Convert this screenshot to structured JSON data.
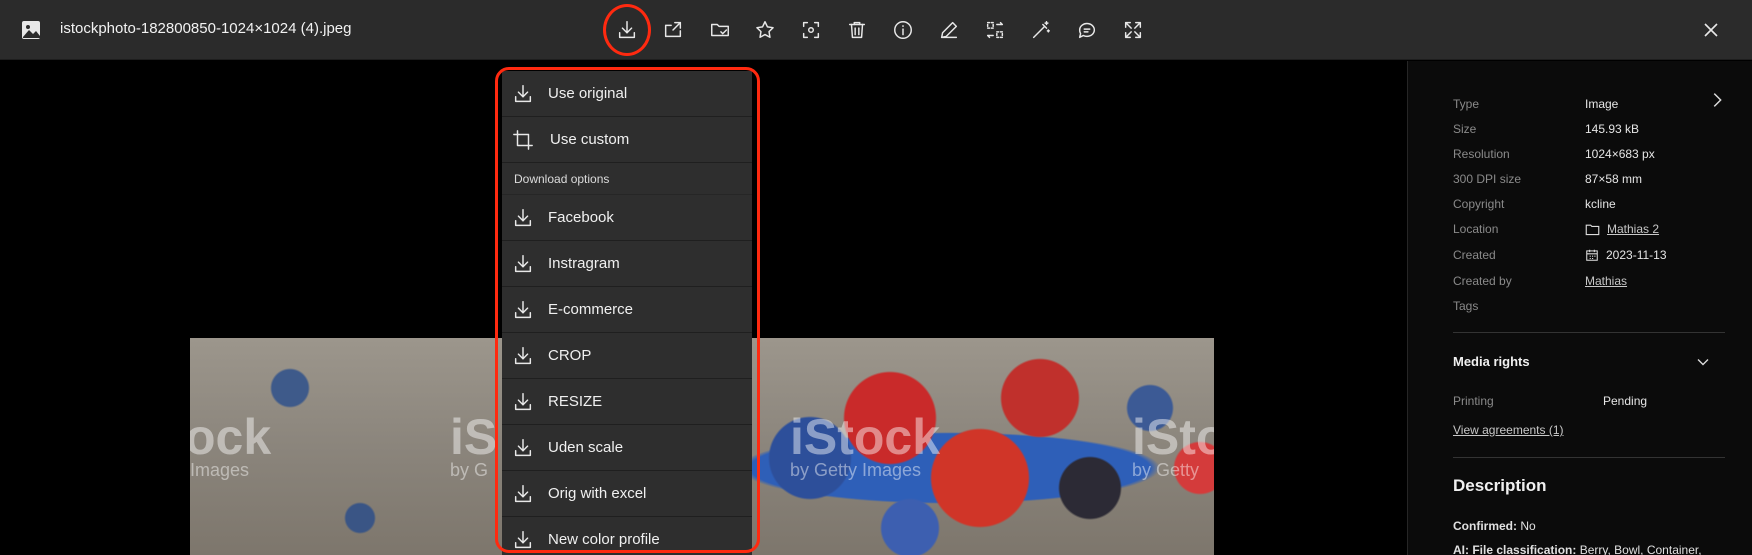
{
  "file": {
    "name": "istockphoto-182800850-1024×1024 (4).jpeg"
  },
  "toolbar": [
    {
      "name": "download-icon",
      "active": true
    },
    {
      "name": "share-icon"
    },
    {
      "name": "move-to-folder-icon"
    },
    {
      "name": "star-icon"
    },
    {
      "name": "focus-icon"
    },
    {
      "name": "trash-icon"
    },
    {
      "name": "info-icon"
    },
    {
      "name": "edit-icon"
    },
    {
      "name": "convert-icon"
    },
    {
      "name": "magic-wand-icon"
    },
    {
      "name": "comment-icon"
    },
    {
      "name": "fullscreen-icon"
    }
  ],
  "menu": {
    "top_items": [
      {
        "label": "Use original",
        "icon": "download-icon"
      },
      {
        "label": "Use custom",
        "icon": "crop-icon"
      }
    ],
    "section_title": "Download options",
    "options": [
      {
        "label": "Facebook"
      },
      {
        "label": "Instragram"
      },
      {
        "label": "E-commerce"
      },
      {
        "label": "CROP"
      },
      {
        "label": "RESIZE"
      },
      {
        "label": "Uden scale"
      },
      {
        "label": "Orig with excel"
      },
      {
        "label": "New color profile"
      }
    ]
  },
  "watermark": {
    "brand": "iStock",
    "sub": "by Getty Images",
    "frag1": "ock",
    "frag1_sub": "Images",
    "frag2": "iS",
    "frag2_sub": "by G",
    "frag4": "iStoc",
    "frag4_sub": "by Getty"
  },
  "properties": [
    {
      "label": "Type",
      "value": "Image"
    },
    {
      "label": "Size",
      "value": "145.93 kB"
    },
    {
      "label": "Resolution",
      "value": "1024×683 px"
    },
    {
      "label": "300 DPI size",
      "value": "87×58 mm"
    },
    {
      "label": "Copyright",
      "value": "kcline"
    },
    {
      "label": "Location",
      "value": "Mathias 2",
      "icon": "folder-icon",
      "link": true
    },
    {
      "label": "Created",
      "value": "2023-11-13",
      "icon": "calendar-icon"
    },
    {
      "label": "Created by",
      "value": "Mathias",
      "link": true
    },
    {
      "label": "Tags",
      "value": ""
    }
  ],
  "media_rights": {
    "title": "Media rights",
    "printing_label": "Printing",
    "printing_value": "Pending",
    "agreements_link": "View agreements (1)"
  },
  "description": {
    "title": "Description",
    "confirmed_label": "Confirmed:",
    "confirmed_value": "No",
    "ai_label": "AI: File classification:",
    "ai_value": "Berry, Bowl, Container,"
  }
}
